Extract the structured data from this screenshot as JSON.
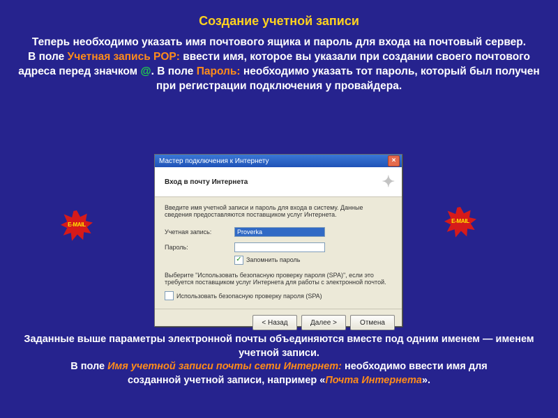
{
  "slide": {
    "title": "Создание учетной записи",
    "intro": {
      "line1": "Теперь необходимо указать имя почтового ящика и пароль для входа на почтовый  сервер.",
      "line2_pre": "В поле ",
      "line2_hl1": "Учетная запись POP:",
      "line2_mid": " ввести имя, которое вы указали при создании своего почтового адреса перед значком ",
      "line2_at": "@",
      "line2_post1": ". В поле ",
      "line2_hl2": "Пароль:",
      "line2_post2": " необходимо указать тот пароль, который был получен при регистрации подключения у провайдера."
    },
    "outro": {
      "line1": "Заданные выше параметры электронной почты объединяются вместе под одним именем — именем учетной записи.",
      "line2_pre": "В поле ",
      "line2_hl1": "Имя учетной записи почты сети Интернет:",
      "line2_mid": " необходимо ввести имя для",
      "line3_pre": "созданной учетной записи, например «",
      "line3_hl": "Почта Интернета",
      "line3_post": "»."
    }
  },
  "dialog": {
    "title": "Мастер подключения к Интернету",
    "subheader": "Вход в почту Интернета",
    "description": "Введите имя учетной записи и пароль для входа в систему. Данные сведения предоставляются поставщиком услуг Интернета.",
    "account_label": "Учетная запись:",
    "account_value": "Proverka",
    "password_label": "Пароль:",
    "password_value": "",
    "remember_label": "Запомнить пароль",
    "remember_checked": true,
    "spa_description": "Выберите \"Использовать безопасную проверку пароля (SPA)\", если это требуется поставщиком услуг Интернета для работы с электронной почтой.",
    "spa_label": "Использовать безопасную проверку пароля (SPA)",
    "spa_checked": false,
    "buttons": {
      "back": "< Назад",
      "next": "Далее >",
      "cancel": "Отмена"
    }
  },
  "icons": {
    "email_burst": "E-MAIL",
    "close_x": "×",
    "check": "✓",
    "wand": "✦"
  }
}
